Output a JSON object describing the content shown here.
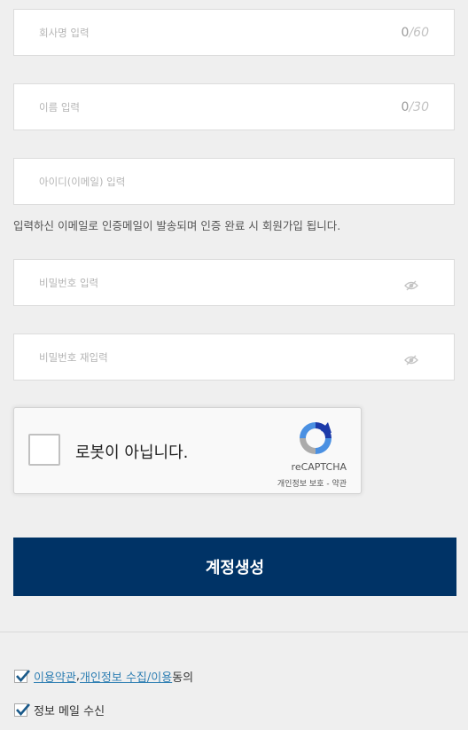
{
  "form": {
    "company": {
      "placeholder": "회사명 입력",
      "count": "0",
      "max": "/60"
    },
    "name": {
      "placeholder": "이름 입력",
      "count": "0",
      "max": "/30"
    },
    "email": {
      "placeholder": "아이디(이메일) 입력"
    },
    "notice": "입력하신 이메일로 인증메일이 발송되며 인증 완료 시 회원가입 됩니다.",
    "password": {
      "placeholder": "비밀번호 입력"
    },
    "password_confirm": {
      "placeholder": "비밀번호 재입력"
    }
  },
  "captcha": {
    "label": "로봇이 아닙니다.",
    "brand": "reCAPTCHA",
    "privacy": "개인정보 보호",
    "separator": " - ",
    "terms": "약관"
  },
  "submit_label": "계정생성",
  "agreements": {
    "terms_link": "이용약관",
    "comma": ", ",
    "privacy_link": "개인정보 수집/이용",
    "agree_suffix": " 동의",
    "email_label": "정보 메일 수신"
  },
  "colors": {
    "accent": "#003366",
    "link": "#2f7fb3",
    "check": "#1a5a8a"
  }
}
